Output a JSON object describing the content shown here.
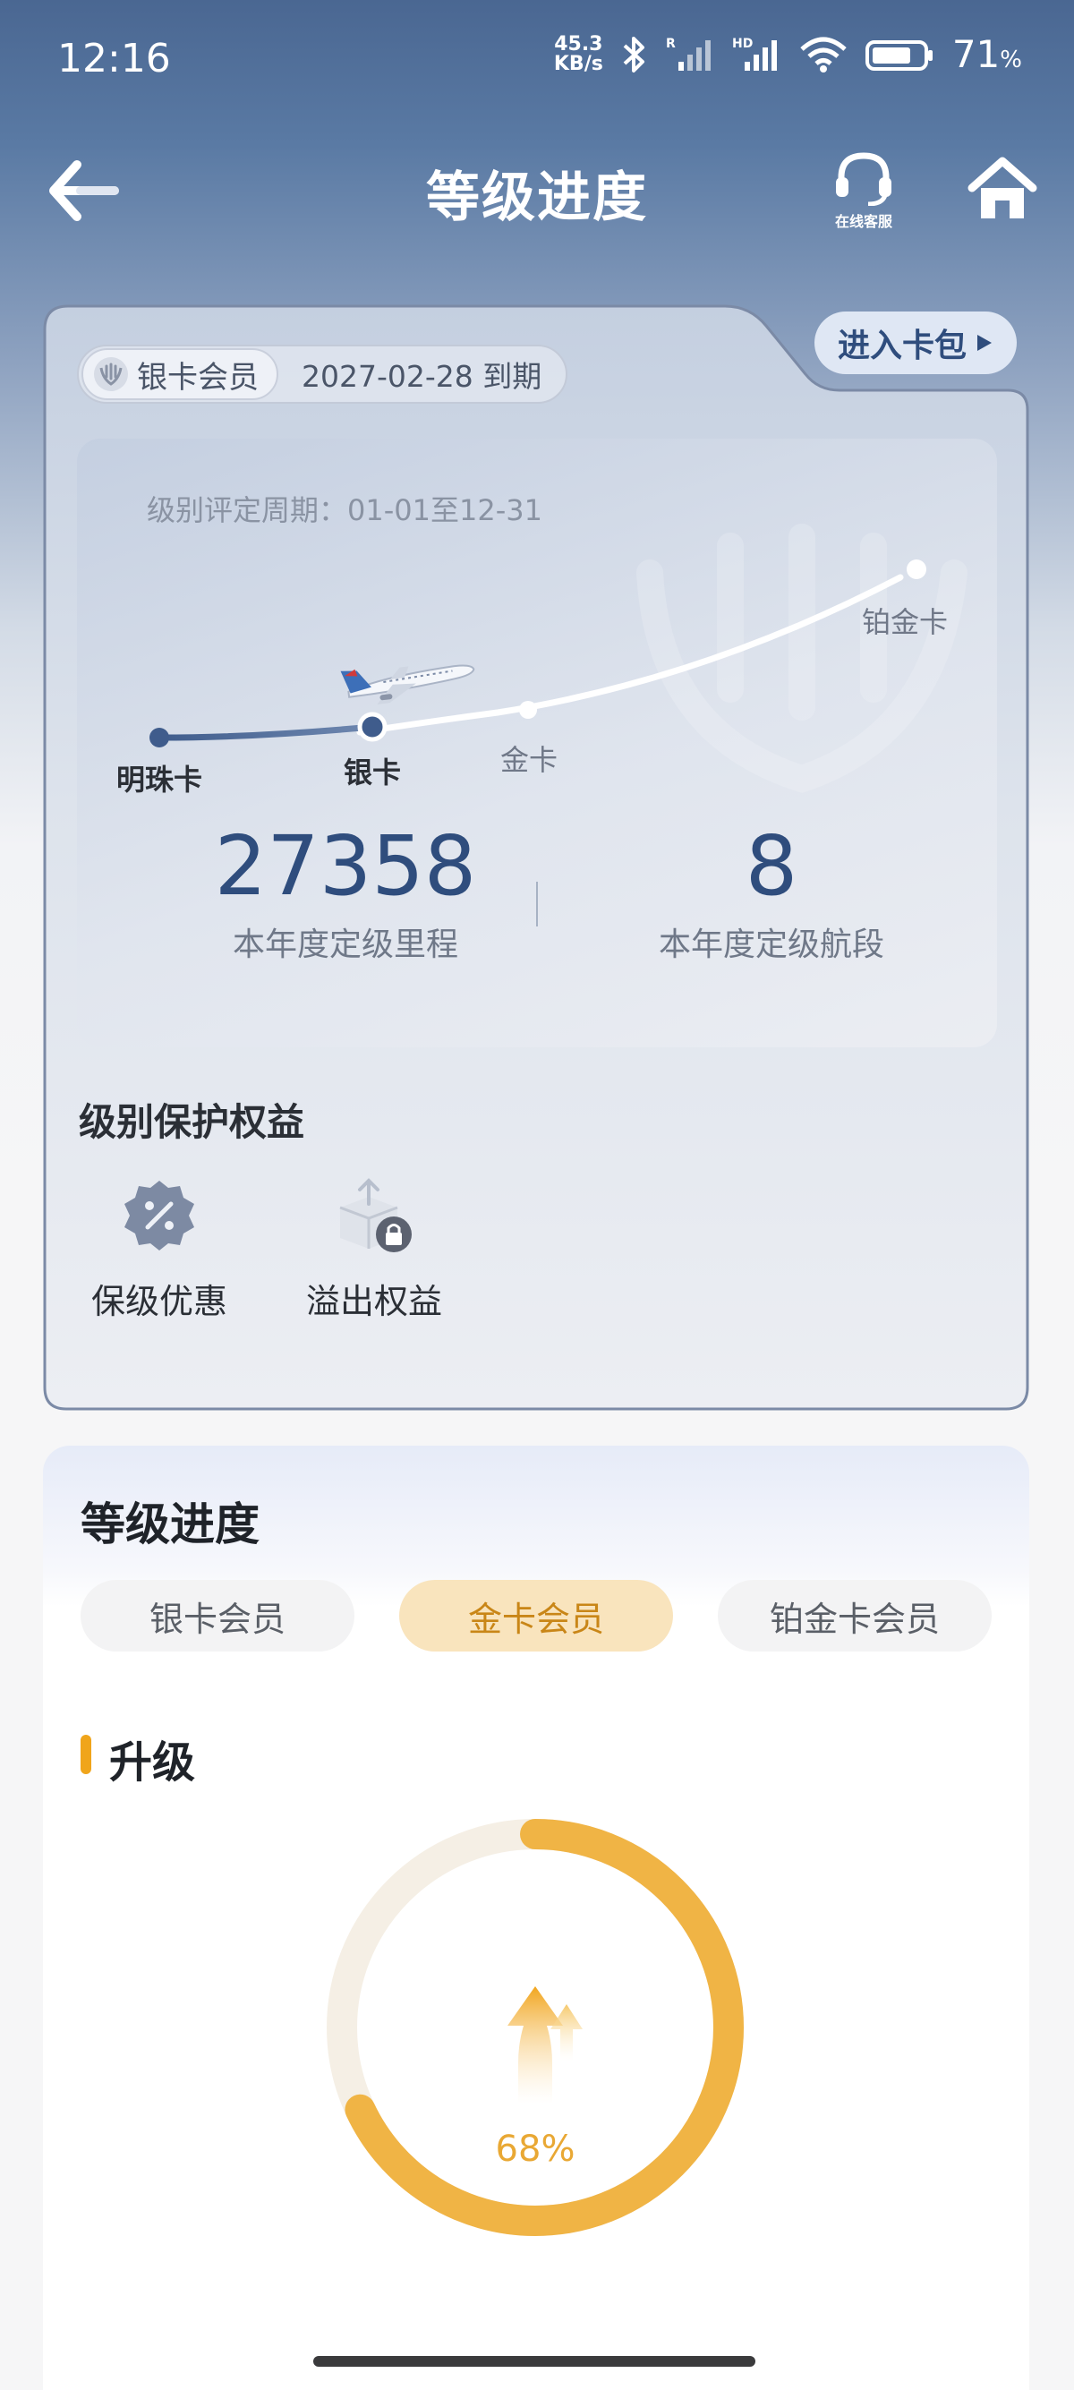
{
  "status_bar": {
    "time": "12:16",
    "net_speed_value": "45.3",
    "net_speed_unit": "KB/s",
    "signal1_tag": "R",
    "signal2_tag": "HD",
    "battery_percent": "71",
    "battery_unit": "%"
  },
  "nav": {
    "title": "等级进度",
    "service_label": "在线客服"
  },
  "member_card": {
    "badge_label": "银卡会员",
    "expire_text": "2027-02-28 到期",
    "wallet_button": "进入卡包",
    "period_text": "级别评定周期：01-01至12-31",
    "levels": [
      "明珠卡",
      "银卡",
      "金卡",
      "铂金卡"
    ],
    "current_level": "银卡",
    "stats": [
      {
        "value": "27358",
        "label": "本年度定级里程"
      },
      {
        "value": "8",
        "label": "本年度定级航段"
      }
    ],
    "protect_title": "级别保护权益",
    "benefits": [
      {
        "label": "保级优惠",
        "icon": "discount-badge-icon"
      },
      {
        "label": "溢出权益",
        "icon": "locked-box-icon"
      }
    ]
  },
  "progress": {
    "title": "等级进度",
    "tabs": [
      "银卡会员",
      "金卡会员",
      "铂金卡会员"
    ],
    "active_tab": "金卡会员",
    "section_title": "升级",
    "percent": 68,
    "percent_label": "68%"
  },
  "colors": {
    "header_blue": "#4a6792",
    "accent_gold": "#f0b445",
    "text_blue": "#2f4d7d"
  }
}
